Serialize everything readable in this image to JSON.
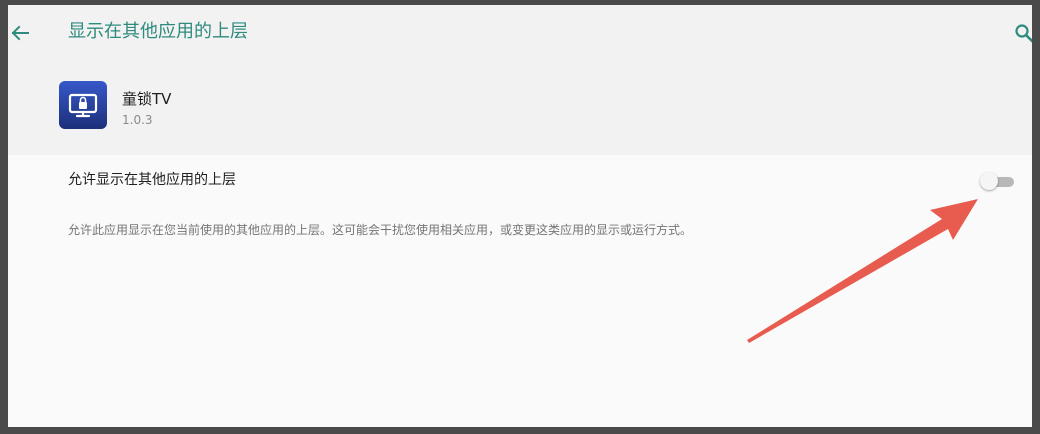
{
  "appbar": {
    "title": "显示在其他应用的上层",
    "back_icon": "arrow-back-icon",
    "search_icon": "search-icon",
    "accent_color": "#2e8b7d"
  },
  "app": {
    "name": "童锁TV",
    "version": "1.0.3",
    "icon": "tv-lock-app-icon"
  },
  "setting": {
    "title": "允许显示在其他应用的上层",
    "toggle_on": false,
    "summary": "允许此应用显示在您当前使用的其他应用的上层。这可能会干扰您使用相关应用，或变更这类应用的显示或运行方式。"
  },
  "annotation": {
    "color": "#e85c50"
  }
}
